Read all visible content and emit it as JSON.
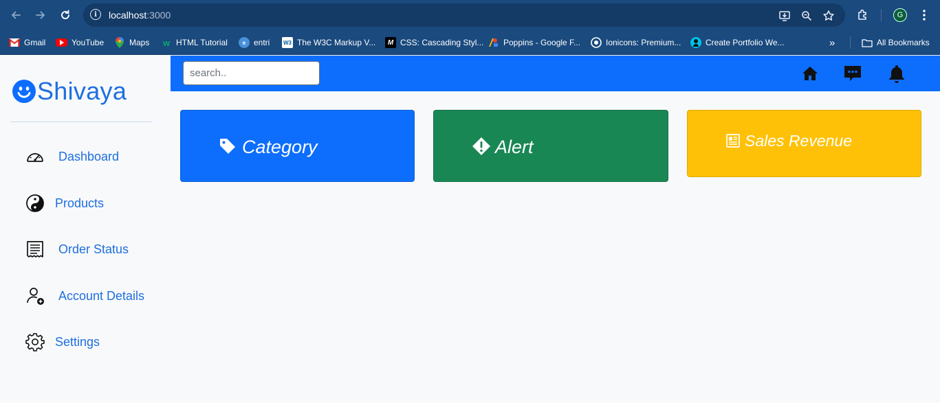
{
  "browser": {
    "url_host": "localhost",
    "url_port": ":3000",
    "profile_initial": "G",
    "bookmarks": [
      {
        "label": "Gmail",
        "icon": "gmail-icon"
      },
      {
        "label": "YouTube",
        "icon": "youtube-icon"
      },
      {
        "label": "Maps",
        "icon": "maps-icon"
      },
      {
        "label": "HTML Tutorial",
        "icon": "w3schools-icon"
      },
      {
        "label": "entri",
        "icon": "entri-icon"
      },
      {
        "label": "The W3C Markup V...",
        "icon": "w3c-icon"
      },
      {
        "label": "CSS: Cascading Styl...",
        "icon": "mdn-icon"
      },
      {
        "label": "Poppins - Google F...",
        "icon": "google-fonts-icon"
      },
      {
        "label": "Ionicons: Premium...",
        "icon": "ionicons-icon"
      },
      {
        "label": "Create Portfolio We...",
        "icon": "portfolio-icon"
      }
    ],
    "overflow_label": "»",
    "all_bookmarks_label": "All Bookmarks"
  },
  "app": {
    "brand": "Shivaya",
    "accent_color": "#0d6efd",
    "search_placeholder": "search..",
    "sidebar": [
      {
        "label": "Dashboard",
        "icon": "speedometer-icon"
      },
      {
        "label": "Products",
        "icon": "yin-yang-icon"
      },
      {
        "label": "Order Status",
        "icon": "receipt-icon"
      },
      {
        "label": "Account Details",
        "icon": "person-add-icon"
      },
      {
        "label": "Settings",
        "icon": "gear-icon"
      }
    ],
    "top_icons": [
      "home-icon",
      "chat-icon",
      "bell-icon"
    ],
    "cards": [
      {
        "label": "Category",
        "icon": "tag-icon",
        "color": "#0d6efd"
      },
      {
        "label": "Alert",
        "icon": "alert-diamond-icon",
        "color": "#198754"
      },
      {
        "label": "Sales Revenue",
        "icon": "newspaper-icon",
        "color": "#ffc107"
      }
    ]
  }
}
